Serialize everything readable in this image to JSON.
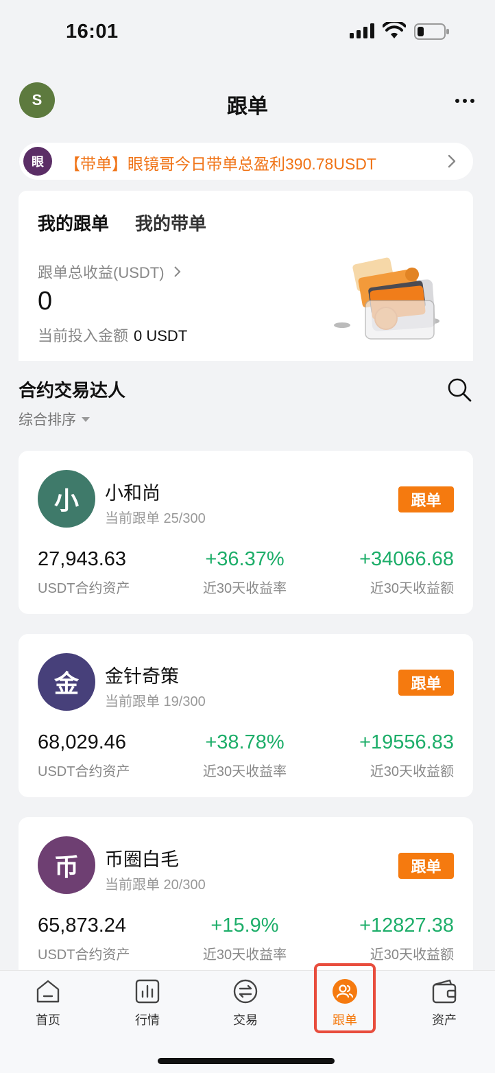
{
  "status_bar": {
    "time": "16:01"
  },
  "header": {
    "avatar_letter": "S",
    "title": "跟单"
  },
  "announcement": {
    "badge": "眼",
    "text": "【带单】眼镜哥今日带单总盈利390.78USDT"
  },
  "my_copy": {
    "tabs": [
      {
        "label": "我的跟单"
      },
      {
        "label": "我的带单"
      }
    ],
    "profit_label": "跟单总收益(USDT)",
    "profit_value": "0",
    "invest_label": "当前投入金额",
    "invest_value": "0 USDT"
  },
  "section": {
    "title": "合约交易达人",
    "sort_label": "综合排序"
  },
  "traders": [
    {
      "avatar": "小",
      "avatar_color": "#3f7a6a",
      "name": "小和尚",
      "sub": "当前跟单 25/300",
      "follow_label": "跟单",
      "assets": "27,943.63",
      "assets_label": "USDT合约资产",
      "rate": "+36.37%",
      "rate_label": "近30天收益率",
      "amount": "+34066.68",
      "amount_label": "近30天收益额"
    },
    {
      "avatar": "金",
      "avatar_color": "#47407a",
      "name": "金针奇策",
      "sub": "当前跟单 19/300",
      "follow_label": "跟单",
      "assets": "68,029.46",
      "assets_label": "USDT合约资产",
      "rate": "+38.78%",
      "rate_label": "近30天收益率",
      "amount": "+19556.83",
      "amount_label": "近30天收益额"
    },
    {
      "avatar": "币",
      "avatar_color": "#6e3f72",
      "name": "币圈白毛",
      "sub": "当前跟单 20/300",
      "follow_label": "跟单",
      "assets": "65,873.24",
      "assets_label": "USDT合约资产",
      "rate": "+15.9%",
      "rate_label": "近30天收益率",
      "amount": "+12827.38",
      "amount_label": "近30天收益额"
    }
  ],
  "bottom_nav": [
    {
      "label": "首页",
      "icon": "home-icon"
    },
    {
      "label": "行情",
      "icon": "market-chart-icon"
    },
    {
      "label": "交易",
      "icon": "trade-swap-icon"
    },
    {
      "label": "跟单",
      "icon": "copy-trade-icon",
      "active": true
    },
    {
      "label": "资产",
      "icon": "wallet-icon"
    }
  ],
  "colors": {
    "accent": "#f57a0f",
    "positive": "#1eae6a",
    "active_highlight": "#e84d3d"
  }
}
